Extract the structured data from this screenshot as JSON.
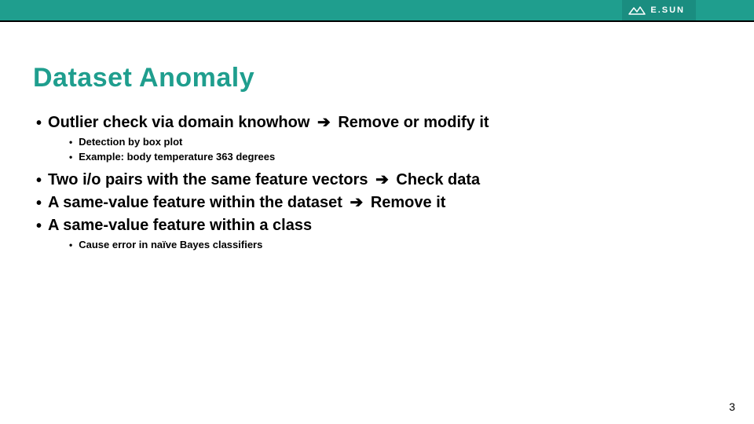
{
  "brand": {
    "name": "E.SUN"
  },
  "title": "Dataset Anomaly",
  "bullets": [
    {
      "pre": "Outlier check via domain knowhow",
      "arrow": "➔",
      "post": " Remove or modify it",
      "subs": [
        "Detection by box plot",
        "Example: body temperature 363 degrees"
      ]
    },
    {
      "pre": "Two i/o pairs with the same feature vectors",
      "arrow": "➔",
      "post": " Check data",
      "subs": []
    },
    {
      "pre": "A same-value feature within the dataset",
      "arrow": "➔",
      "post": " Remove it",
      "subs": []
    },
    {
      "pre": "A same-value feature within a class",
      "arrow": "",
      "post": "",
      "subs": [
        "Cause error in naïve Bayes classifiers"
      ]
    }
  ],
  "page_number": "3"
}
